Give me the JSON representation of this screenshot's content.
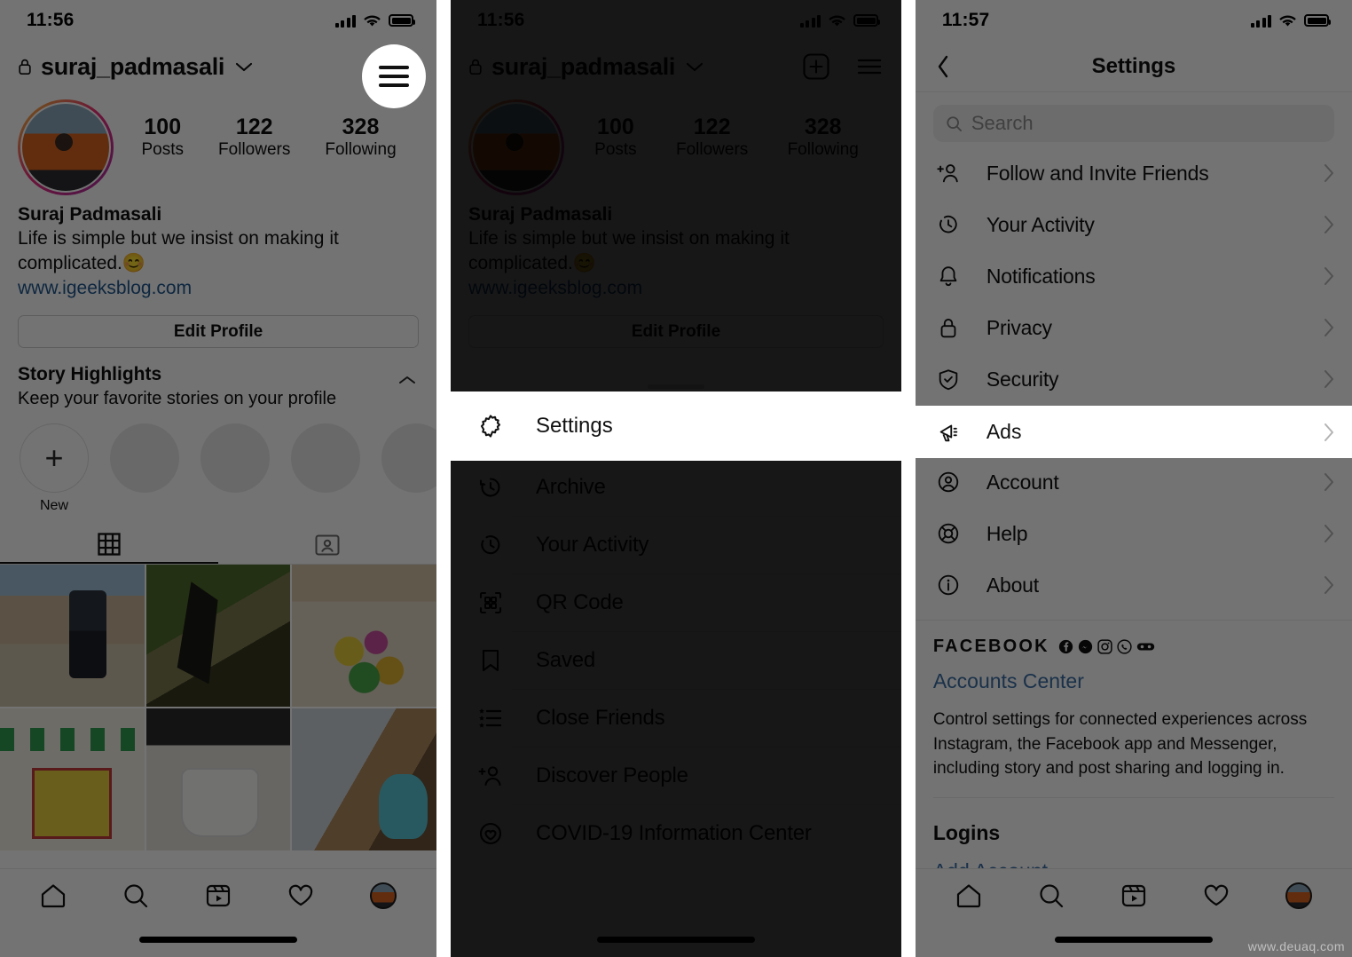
{
  "watermark": "www.deuaq.com",
  "panel1": {
    "status": {
      "time": "11:56",
      "signal_icon": "cellular-bars-icon",
      "wifi_icon": "wifi-icon",
      "battery_icon": "battery-icon"
    },
    "profile": {
      "username": "suraj_padmasali",
      "lock_icon": "lock-icon",
      "chevron_icon": "chevron-down-icon",
      "add_icon": "add-post-icon",
      "menu_icon": "hamburger-menu-icon",
      "stats": [
        {
          "value": "100",
          "label": "Posts"
        },
        {
          "value": "122",
          "label": "Followers"
        },
        {
          "value": "328",
          "label": "Following"
        }
      ],
      "full_name": "Suraj Padmasali",
      "bio": "Life is simple but we insist on making it complicated.😊",
      "website": "www.igeeksblog.com",
      "edit_profile": "Edit Profile"
    },
    "highlights": {
      "title": "Story Highlights",
      "subtitle": "Keep your favorite stories on your profile",
      "collapse_icon": "chevron-up-icon",
      "new_label": "New",
      "plus_icon": "plus-icon"
    },
    "tabs": [
      {
        "name": "grid-tab",
        "icon": "grid-icon",
        "active": true
      },
      {
        "name": "tagged-tab",
        "icon": "tagged-photos-icon",
        "active": false
      }
    ],
    "bottom_nav": [
      {
        "name": "home",
        "icon": "home-icon"
      },
      {
        "name": "search",
        "icon": "search-icon"
      },
      {
        "name": "reels",
        "icon": "reels-icon"
      },
      {
        "name": "activity",
        "icon": "heart-icon"
      },
      {
        "name": "profile",
        "icon": "profile-avatar-icon"
      }
    ],
    "spotlight_target": "hamburger-menu-icon"
  },
  "panel2": {
    "status": {
      "time": "11:56"
    },
    "sheet": {
      "handle_icon": "drag-handle",
      "items": [
        {
          "label": "Settings",
          "icon": "settings-gear-icon",
          "highlighted": true
        },
        {
          "label": "Archive",
          "icon": "archive-clock-icon",
          "highlighted": false
        },
        {
          "label": "Your Activity",
          "icon": "activity-clock-icon",
          "highlighted": false
        },
        {
          "label": "QR Code",
          "icon": "qr-code-icon",
          "highlighted": false
        },
        {
          "label": "Saved",
          "icon": "bookmark-icon",
          "highlighted": false
        },
        {
          "label": "Close Friends",
          "icon": "close-friends-list-icon",
          "highlighted": false
        },
        {
          "label": "Discover People",
          "icon": "discover-people-icon",
          "highlighted": false
        },
        {
          "label": "COVID-19 Information Center",
          "icon": "covid-info-icon",
          "highlighted": false
        }
      ]
    }
  },
  "panel3": {
    "status": {
      "time": "11:57"
    },
    "header": {
      "title": "Settings",
      "back_icon": "chevron-left-icon"
    },
    "search": {
      "placeholder": "Search",
      "icon": "search-icon"
    },
    "items": [
      {
        "label": "Follow and Invite Friends",
        "icon": "add-person-icon",
        "highlighted": false
      },
      {
        "label": "Your Activity",
        "icon": "activity-clock-icon",
        "highlighted": false
      },
      {
        "label": "Notifications",
        "icon": "bell-icon",
        "highlighted": false
      },
      {
        "label": "Privacy",
        "icon": "lock-icon",
        "highlighted": false
      },
      {
        "label": "Security",
        "icon": "shield-check-icon",
        "highlighted": false
      },
      {
        "label": "Ads",
        "icon": "megaphone-icon",
        "highlighted": true
      },
      {
        "label": "Account",
        "icon": "account-circle-icon",
        "highlighted": false
      },
      {
        "label": "Help",
        "icon": "lifebuoy-icon",
        "highlighted": false
      },
      {
        "label": "About",
        "icon": "info-circle-icon",
        "highlighted": false
      }
    ],
    "facebook": {
      "label": "FACEBOOK",
      "app_icons": [
        "facebook-icon",
        "messenger-icon",
        "instagram-icon",
        "whatsapp-icon",
        "oculus-icon"
      ],
      "accounts_center": "Accounts Center",
      "description": "Control settings for connected experiences across Instagram, the Facebook app and Messenger, including story and post sharing and logging in.",
      "logins_title": "Logins",
      "add_account": "Add Account"
    },
    "bottom_nav": [
      {
        "name": "home",
        "icon": "home-icon"
      },
      {
        "name": "search",
        "icon": "search-icon"
      },
      {
        "name": "reels",
        "icon": "reels-icon"
      },
      {
        "name": "activity",
        "icon": "heart-icon"
      },
      {
        "name": "profile",
        "icon": "profile-avatar-icon"
      }
    ],
    "spotlight_target": "Ads"
  },
  "colors": {
    "dim_overlay": "#4e4c4a",
    "highlight_bg": "#ffffff",
    "link": "#3a6ea5",
    "bio_link": "#20578f"
  }
}
